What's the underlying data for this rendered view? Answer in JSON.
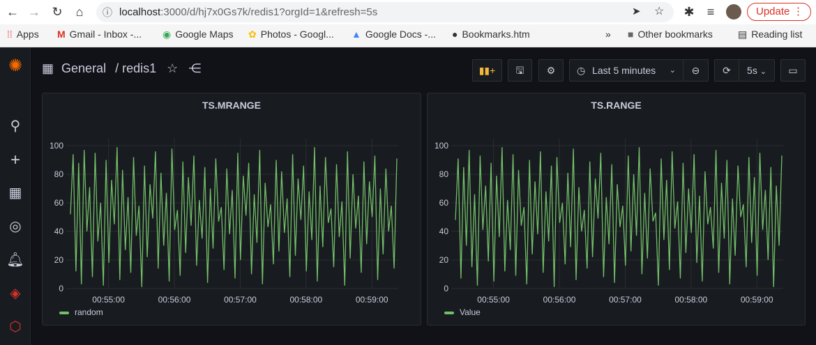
{
  "browser": {
    "url_host": "localhost",
    "url_rest": ":3000/d/hj7x0Gs7k/redis1?orgId=1&refresh=5s",
    "update_label": "Update",
    "bookmarks": [
      "Apps",
      "Gmail - Inbox -...",
      "Google Maps",
      "Photos - Googl...",
      "Google Docs -...",
      "Bookmarks.htm"
    ],
    "other_bookmarks": "Other bookmarks",
    "reading_list": "Reading list"
  },
  "dashboard": {
    "folder": "General",
    "separator": "/",
    "name": "redis1",
    "time_range": "Last 5 minutes",
    "refresh": "5s"
  },
  "colors": {
    "series": "#73bf69",
    "update": "#d93025"
  },
  "chart_data": [
    {
      "type": "line",
      "title": "TS.MRANGE",
      "series": [
        {
          "name": "random",
          "values": [
            52,
            94,
            12,
            88,
            3,
            97,
            40,
            71,
            8,
            95,
            33,
            60,
            2,
            90,
            18,
            76,
            45,
            99,
            6,
            83,
            27,
            64,
            11,
            92,
            37,
            58,
            1,
            86,
            22,
            73,
            49,
            96,
            14,
            81,
            30,
            67,
            5,
            98,
            41,
            55,
            9,
            89,
            25,
            78,
            44,
            93,
            16,
            62,
            35,
            85,
            4,
            70,
            28,
            91,
            47,
            57,
            13,
            84,
            38,
            69,
            7,
            95,
            20,
            79,
            51,
            88,
            10,
            66,
            32,
            97,
            3,
            74,
            43,
            59,
            17,
            90,
            26,
            82,
            39,
            63,
            8,
            94,
            23,
            77,
            48,
            86,
            12,
            68,
            34,
            99,
            5,
            72,
            29,
            92,
            46,
            56,
            15,
            87,
            36,
            61,
            2,
            96,
            21,
            80,
            42,
            65,
            11,
            89,
            31,
            75,
            50,
            93,
            6,
            70,
            24,
            84,
            40,
            58,
            14,
            91
          ]
        }
      ],
      "x_ticks": [
        "00:55:00",
        "00:56:00",
        "00:57:00",
        "00:58:00",
        "00:59:00"
      ],
      "x_range": [
        "00:54:24",
        "00:59:24"
      ],
      "y_ticks": [
        0,
        20,
        40,
        60,
        80,
        100
      ],
      "ylim": [
        0,
        100
      ],
      "grid": true,
      "legend": "bottom-left"
    },
    {
      "type": "line",
      "title": "TS.RANGE",
      "series": [
        {
          "name": "Value",
          "values": [
            48,
            91,
            7,
            85,
            30,
            97,
            15,
            66,
            2,
            93,
            41,
            72,
            19,
            88,
            5,
            79,
            36,
            99,
            12,
            62,
            27,
            94,
            9,
            83,
            44,
            57,
            3,
            90,
            24,
            75,
            38,
            96,
            11,
            68,
            33,
            86,
            1,
            92,
            46,
            60,
            17,
            81,
            29,
            98,
            6,
            71,
            40,
            55,
            14,
            89,
            22,
            77,
            49,
            95,
            8,
            64,
            31,
            87,
            4,
            73,
            43,
            58,
            16,
            93,
            26,
            80,
            37,
            99,
            10,
            67,
            21,
            84,
            47,
            53,
            2,
            91,
            34,
            76,
            13,
            96,
            42,
            61,
            7,
            88,
            25,
            70,
            39,
            94,
            18,
            65,
            5,
            82,
            45,
            57,
            28,
            97,
            11,
            74,
            35,
            90,
            3,
            63,
            23,
            86,
            50,
            59,
            15,
            92,
            32,
            78,
            9,
            95,
            41,
            69,
            20,
            85,
            1,
            72,
            30,
            93
          ]
        }
      ],
      "x_ticks": [
        "00:55:00",
        "00:56:00",
        "00:57:00",
        "00:58:00",
        "00:59:00"
      ],
      "x_range": [
        "00:54:24",
        "00:59:24"
      ],
      "y_ticks": [
        0,
        20,
        40,
        60,
        80,
        100
      ],
      "ylim": [
        0,
        100
      ],
      "grid": true,
      "legend": "bottom-left"
    }
  ]
}
